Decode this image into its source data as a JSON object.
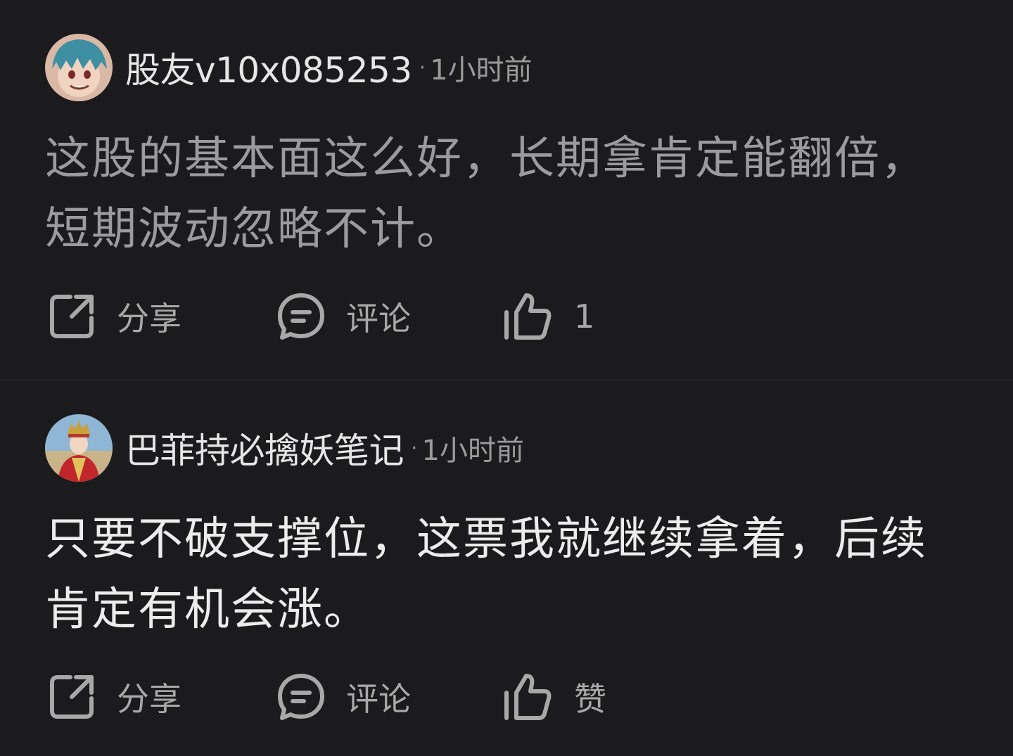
{
  "posts": [
    {
      "username": "股友v10x085253",
      "dot": "·",
      "time": "1小时前",
      "content_line1": "这股的基本面这么好，长期拿肯定能翻倍，",
      "content_line2": "短期波动忽略不计。",
      "share_label": "分享",
      "comment_label": "评论",
      "like_label": "1"
    },
    {
      "username": "巴菲持必擒妖笔记",
      "dot": "·",
      "time": "1小时前",
      "content_line1": "只要不破支撑位，这票我就继续拿着，后续",
      "content_line2": "肯定有机会涨。",
      "share_label": "分享",
      "comment_label": "评论",
      "like_label": "赞"
    }
  ],
  "icons": {
    "share": "share-icon",
    "comment": "comment-icon",
    "like": "thumbs-up-icon"
  },
  "colors": {
    "background": "#1b1b1d",
    "divider": "#2c2c2f",
    "text_primary": "#ececec",
    "text_muted": "#9b9b9d"
  }
}
